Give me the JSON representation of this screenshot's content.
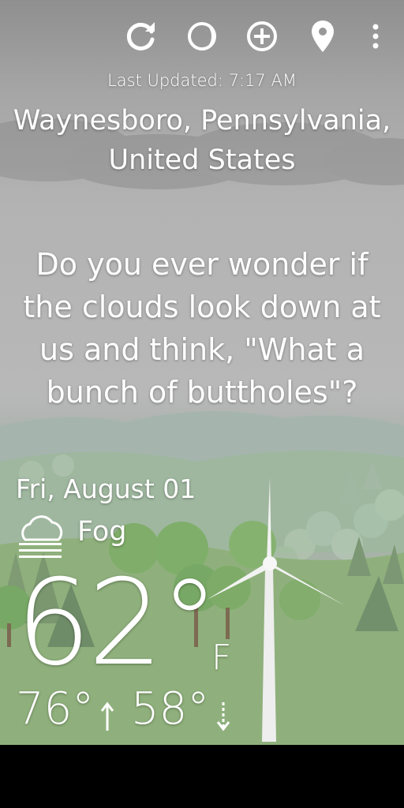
{
  "toolbar": {
    "icons": [
      "refresh-icon",
      "moon-phase-icon",
      "add-location-icon",
      "location-pin-icon",
      "overflow-menu-icon"
    ]
  },
  "header": {
    "last_updated": "Last Updated: 7:17 AM",
    "location_line1": "Waynesboro, Pennsylvania,",
    "location_line2": "United States"
  },
  "quote": {
    "text": "Do you ever wonder if the clouds look down at us and think, \"What a bunch of buttholes\"?"
  },
  "forecast": {
    "date": "Fri, August 01",
    "condition": "Fog",
    "condition_icon": "fog-icon",
    "temperature": "62°",
    "unit": "F",
    "high": "76°",
    "high_icon": "arrow-up-icon",
    "low": "58°",
    "low_icon": "arrow-down-icon"
  },
  "colors": {
    "text": "#ffffff",
    "sky_top": "#8f8f8f",
    "sky_bottom": "#b8b8b8",
    "grass": "#8fb07c",
    "tree": "#7aa867",
    "nav_bar": "#000000"
  }
}
